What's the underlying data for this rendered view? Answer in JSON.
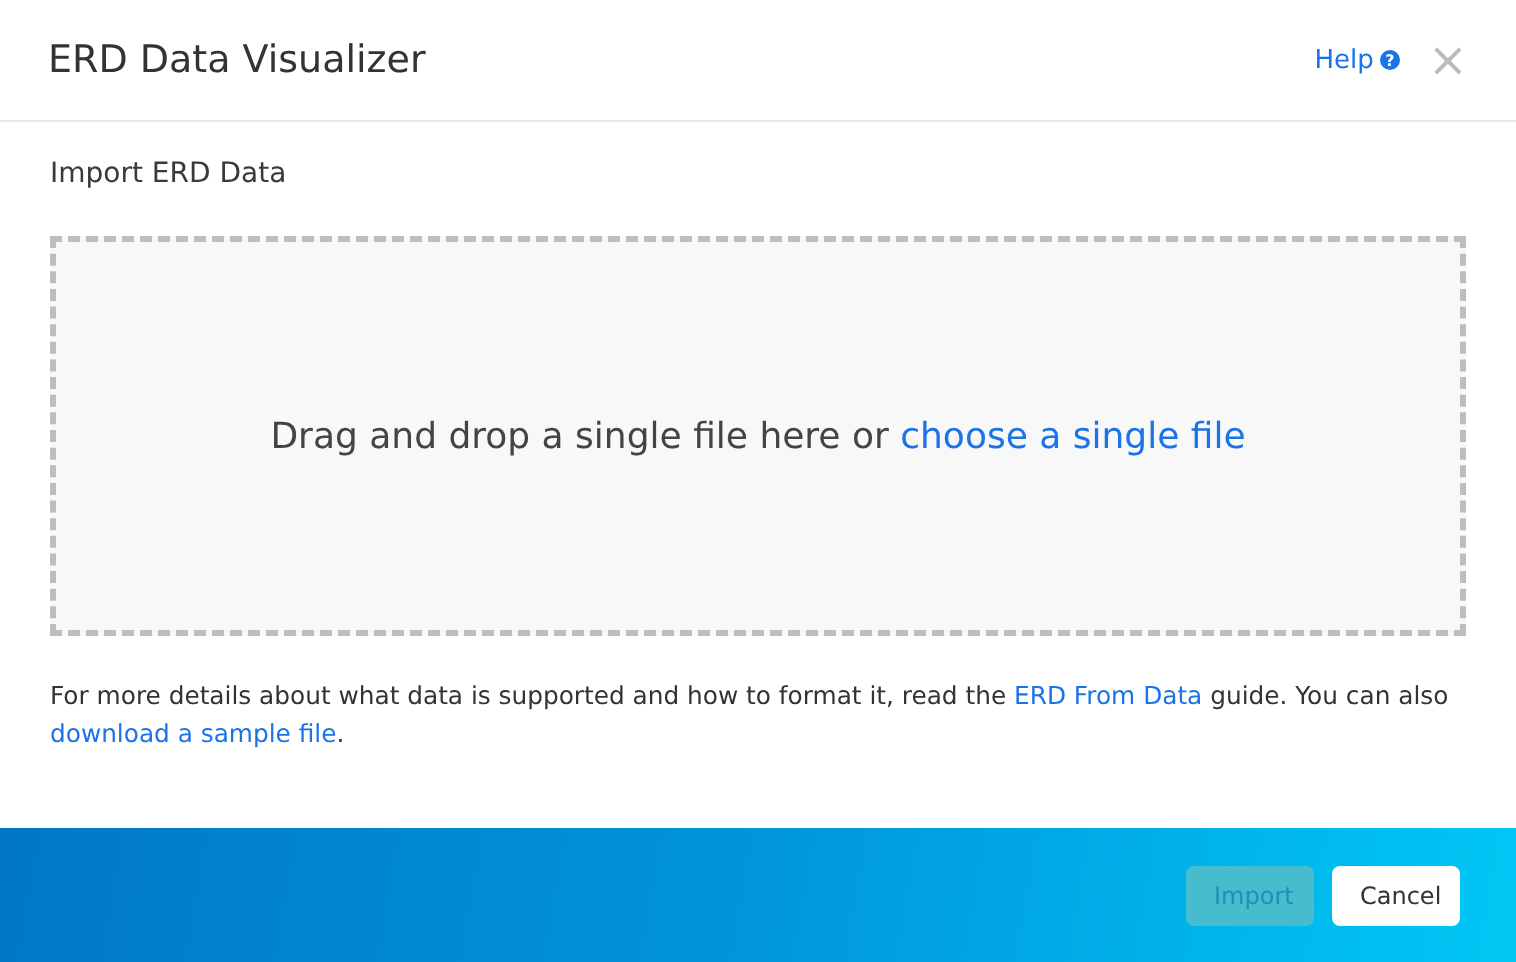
{
  "window": {
    "title": "ERD Data Visualizer",
    "help": "Help",
    "help_icon": "?",
    "close": "×"
  },
  "section_title": "Import ERD Data",
  "dropzone": {
    "text": "Drag and drop a single file here or",
    "link": "choose a single file"
  },
  "note": [
    {
      "kind": "text",
      "text": "For more details about what data is supported and how to format it, read the "
    },
    {
      "kind": "link",
      "text": "ERD From Data"
    },
    {
      "kind": "text",
      "text": " guide. You can also "
    },
    {
      "kind": "link",
      "text": "download a sample file"
    },
    {
      "kind": "text",
      "text": "."
    }
  ],
  "buttons": [
    {
      "label": "Import",
      "disabled": true
    },
    {
      "label": "Cancel",
      "disabled": false
    }
  ]
}
